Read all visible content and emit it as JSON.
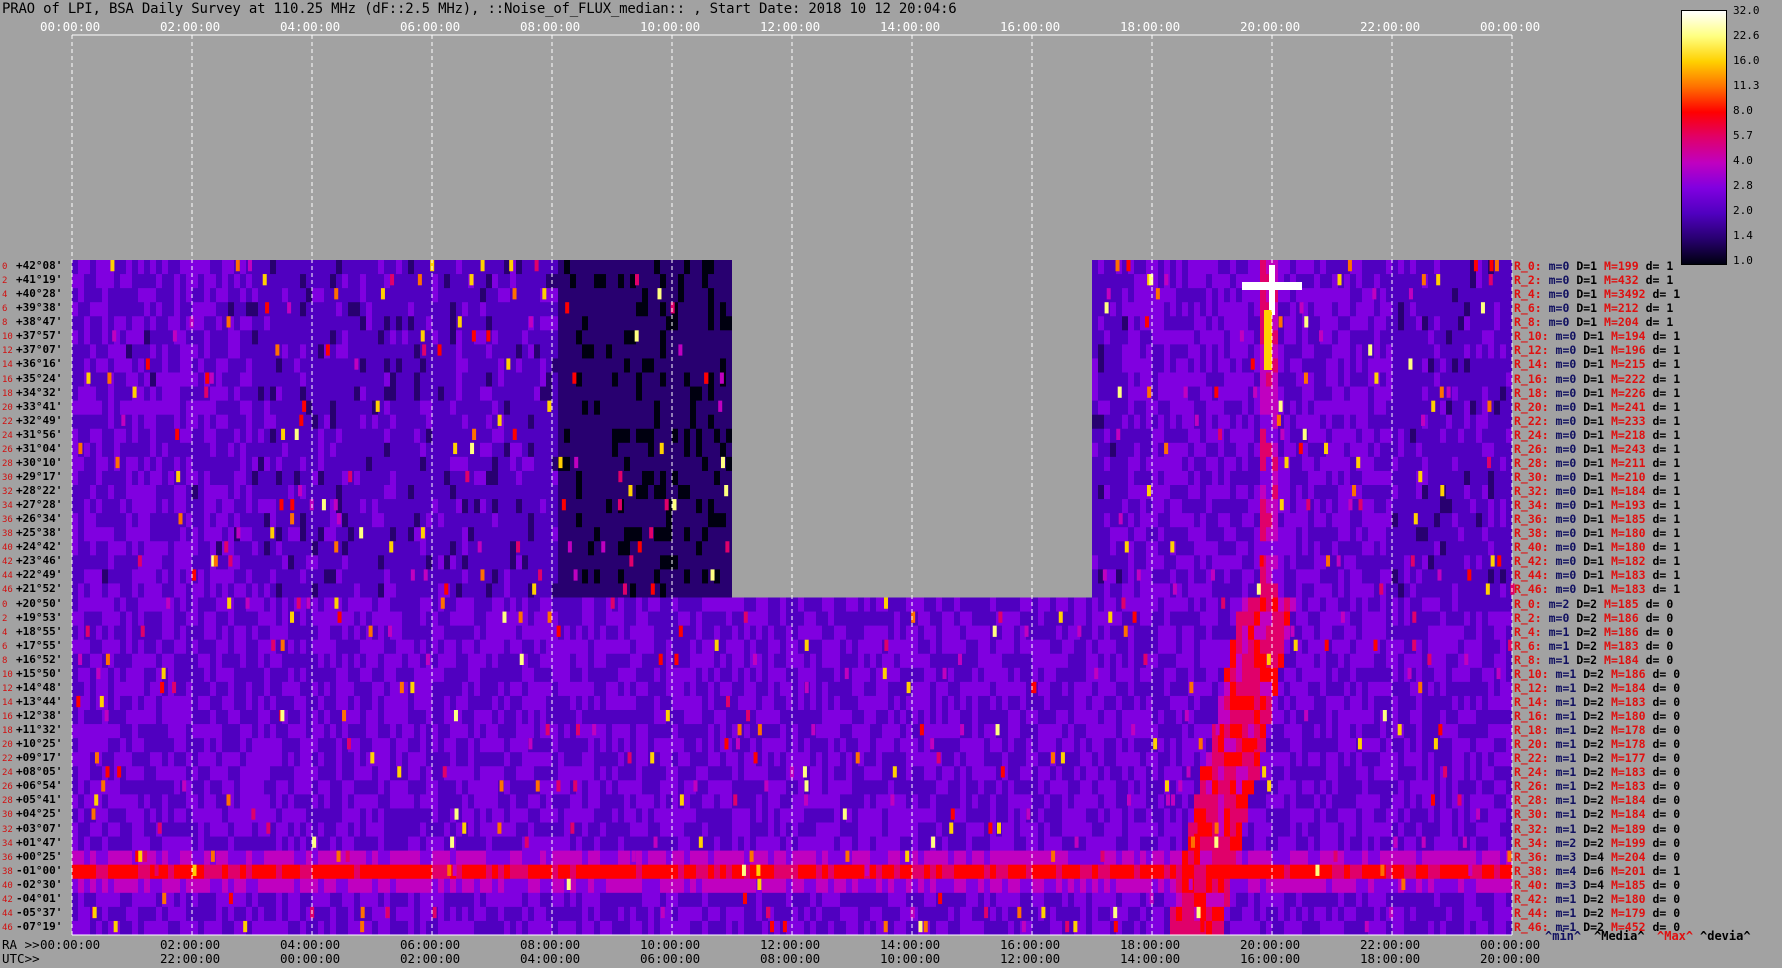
{
  "title": "PRAO of LPI, BSA Daily Survey at 110.25 MHz (dF::2.5 MHz), ::Noise_of_FLUX_median:: , Start Date: 2018 10 12 20:04:6",
  "chart_data": {
    "type": "heatmap",
    "title": "PRAO of LPI, BSA Daily Survey at 110.25 MHz (dF::2.5 MHz), ::Noise_of_FLUX_median:: , Start Date: 2018 10 12 20:04:6",
    "x_top_ticks": [
      "00:00:00",
      "02:00:00",
      "04:00:00",
      "06:00:00",
      "08:00:00",
      "10:00:00",
      "12:00:00",
      "14:00:00",
      "16:00:00",
      "18:00:00",
      "20:00:00",
      "22:00:00",
      "00:00:00"
    ],
    "x_bottom_ra_ticks": [
      "00:00:00",
      "02:00:00",
      "04:00:00",
      "06:00:00",
      "08:00:00",
      "10:00:00",
      "12:00:00",
      "14:00:00",
      "16:00:00",
      "18:00:00",
      "20:00:00",
      "22:00:00",
      "00:00:00"
    ],
    "x_bottom_utc_ticks": [
      "22:00:00",
      "00:00:00",
      "02:00:00",
      "04:00:00",
      "06:00:00",
      "08:00:00",
      "10:00:00",
      "12:00:00",
      "14:00:00",
      "16:00:00",
      "18:00:00",
      "20:00:00"
    ],
    "ra_axis_label": "RA >>",
    "utc_axis_label": "UTC>>",
    "xlim_hours": [
      0,
      24
    ],
    "declinations": [
      "+42°08'",
      "+41°19'",
      "+40°28'",
      "+39°38'",
      "+38°47'",
      "+37°57'",
      "+37°07'",
      "+36°16'",
      "+35°24'",
      "+34°32'",
      "+33°41'",
      "+32°49'",
      "+31°56'",
      "+31°04'",
      "+30°10'",
      "+29°17'",
      "+28°22'",
      "+27°28'",
      "+26°34'",
      "+25°38'",
      "+24°42'",
      "+23°46'",
      "+22°49'",
      "+21°52'",
      "+20°50'",
      "+19°53'",
      "+18°55'",
      "+17°55'",
      "+16°52'",
      "+15°50'",
      "+14°48'",
      "+13°44'",
      "+12°38'",
      "+11°32'",
      "+10°25'",
      "+09°17'",
      "+08°05'",
      "+06°54'",
      "+05°41'",
      "+04°25'",
      "+03°07'",
      "+01°47'",
      "+00°25'",
      "-01°00'",
      "-02°30'",
      "-04°01'",
      "-05°37'",
      "-07°19'"
    ],
    "row_indices_left": [
      "0",
      "2",
      "4",
      "6",
      "8",
      "10",
      "12",
      "14",
      "16",
      "18",
      "20",
      "22",
      "24",
      "26",
      "28",
      "30",
      "32",
      "34",
      "36",
      "38",
      "40",
      "42",
      "44",
      "46",
      "0",
      "2",
      "4",
      "6",
      "8",
      "10",
      "12",
      "14",
      "16",
      "18",
      "20",
      "22",
      "24",
      "26",
      "28",
      "30",
      "32",
      "34",
      "36",
      "38",
      "40",
      "42",
      "44",
      "46"
    ],
    "missing_data_hours": [
      {
        "rows": "upper",
        "from": 11.0,
        "to": 17.0
      },
      {
        "rows": "lower",
        "from": 0,
        "to": 0
      }
    ],
    "features": [
      {
        "name": "radio source band",
        "dec": "-01°00'",
        "level": 8.0
      },
      {
        "name": "bright source",
        "ra_hours": 20.0,
        "dec": "+41°19'",
        "level": 32.0
      },
      {
        "name": "drifting interference track",
        "ra_from_hours": 18.6,
        "ra_to_hours": 20.0,
        "level": 11.3
      }
    ],
    "colorbar": {
      "ticks": [
        "32.0",
        "22.6",
        "16.0",
        "11.3",
        "8.0",
        "5.7",
        "4.0",
        "2.8",
        "2.0",
        "1.4",
        "1.0"
      ],
      "scale": "log",
      "colors": [
        "#ffffff",
        "#ffff80",
        "#ffd000",
        "#ff7000",
        "#ff0000",
        "#e0006a",
        "#c000c0",
        "#8000e0",
        "#5000c0",
        "#280070",
        "#000010"
      ]
    }
  },
  "row_stats": [
    {
      "r": "R_0:",
      "mn": "m=0",
      "dv": "D=1",
      "mx": "M=199",
      "d": "d= 1"
    },
    {
      "r": "R_2:",
      "mn": "m=0",
      "dv": "D=1",
      "mx": "M=432",
      "d": "d= 1"
    },
    {
      "r": "R_4:",
      "mn": "m=0",
      "dv": "D=1",
      "mx": "M=3492",
      "d": "d= 1"
    },
    {
      "r": "R_6:",
      "mn": "m=0",
      "dv": "D=1",
      "mx": "M=212",
      "d": "d= 1"
    },
    {
      "r": "R_8:",
      "mn": "m=0",
      "dv": "D=1",
      "mx": "M=204",
      "d": "d= 1"
    },
    {
      "r": "R_10:",
      "mn": "m=0",
      "dv": "D=1",
      "mx": "M=194",
      "d": "d= 1"
    },
    {
      "r": "R_12:",
      "mn": "m=0",
      "dv": "D=1",
      "mx": "M=196",
      "d": "d= 1"
    },
    {
      "r": "R_14:",
      "mn": "m=0",
      "dv": "D=1",
      "mx": "M=215",
      "d": "d= 1"
    },
    {
      "r": "R_16:",
      "mn": "m=0",
      "dv": "D=1",
      "mx": "M=222",
      "d": "d= 1"
    },
    {
      "r": "R_18:",
      "mn": "m=0",
      "dv": "D=1",
      "mx": "M=226",
      "d": "d= 1"
    },
    {
      "r": "R_20:",
      "mn": "m=0",
      "dv": "D=1",
      "mx": "M=241",
      "d": "d= 1"
    },
    {
      "r": "R_22:",
      "mn": "m=0",
      "dv": "D=1",
      "mx": "M=233",
      "d": "d= 1"
    },
    {
      "r": "R_24:",
      "mn": "m=0",
      "dv": "D=1",
      "mx": "M=218",
      "d": "d= 1"
    },
    {
      "r": "R_26:",
      "mn": "m=0",
      "dv": "D=1",
      "mx": "M=243",
      "d": "d= 1"
    },
    {
      "r": "R_28:",
      "mn": "m=0",
      "dv": "D=1",
      "mx": "M=211",
      "d": "d= 1"
    },
    {
      "r": "R_30:",
      "mn": "m=0",
      "dv": "D=1",
      "mx": "M=210",
      "d": "d= 1"
    },
    {
      "r": "R_32:",
      "mn": "m=0",
      "dv": "D=1",
      "mx": "M=184",
      "d": "d= 1"
    },
    {
      "r": "R_34:",
      "mn": "m=0",
      "dv": "D=1",
      "mx": "M=193",
      "d": "d= 1"
    },
    {
      "r": "R_36:",
      "mn": "m=0",
      "dv": "D=1",
      "mx": "M=185",
      "d": "d= 1"
    },
    {
      "r": "R_38:",
      "mn": "m=0",
      "dv": "D=1",
      "mx": "M=180",
      "d": "d= 1"
    },
    {
      "r": "R_40:",
      "mn": "m=0",
      "dv": "D=1",
      "mx": "M=180",
      "d": "d= 1"
    },
    {
      "r": "R_42:",
      "mn": "m=0",
      "dv": "D=1",
      "mx": "M=182",
      "d": "d= 1"
    },
    {
      "r": "R_44:",
      "mn": "m=0",
      "dv": "D=1",
      "mx": "M=183",
      "d": "d= 1"
    },
    {
      "r": "R_46:",
      "mn": "m=0",
      "dv": "D=1",
      "mx": "M=183",
      "d": "d= 1"
    },
    {
      "r": "R_0:",
      "mn": "m=2",
      "dv": "D=2",
      "mx": "M=185",
      "d": "d= 0"
    },
    {
      "r": "R_2:",
      "mn": "m=0",
      "dv": "D=2",
      "mx": "M=186",
      "d": "d= 0"
    },
    {
      "r": "R_4:",
      "mn": "m=1",
      "dv": "D=2",
      "mx": "M=186",
      "d": "d= 0"
    },
    {
      "r": "R_6:",
      "mn": "m=1",
      "dv": "D=2",
      "mx": "M=183",
      "d": "d= 0"
    },
    {
      "r": "R_8:",
      "mn": "m=1",
      "dv": "D=2",
      "mx": "M=184",
      "d": "d= 0"
    },
    {
      "r": "R_10:",
      "mn": "m=1",
      "dv": "D=2",
      "mx": "M=186",
      "d": "d= 0"
    },
    {
      "r": "R_12:",
      "mn": "m=1",
      "dv": "D=2",
      "mx": "M=184",
      "d": "d= 0"
    },
    {
      "r": "R_14:",
      "mn": "m=1",
      "dv": "D=2",
      "mx": "M=183",
      "d": "d= 0"
    },
    {
      "r": "R_16:",
      "mn": "m=1",
      "dv": "D=2",
      "mx": "M=180",
      "d": "d= 0"
    },
    {
      "r": "R_18:",
      "mn": "m=1",
      "dv": "D=2",
      "mx": "M=178",
      "d": "d= 0"
    },
    {
      "r": "R_20:",
      "mn": "m=1",
      "dv": "D=2",
      "mx": "M=178",
      "d": "d= 0"
    },
    {
      "r": "R_22:",
      "mn": "m=1",
      "dv": "D=2",
      "mx": "M=177",
      "d": "d= 0"
    },
    {
      "r": "R_24:",
      "mn": "m=1",
      "dv": "D=2",
      "mx": "M=183",
      "d": "d= 0"
    },
    {
      "r": "R_26:",
      "mn": "m=1",
      "dv": "D=2",
      "mx": "M=183",
      "d": "d= 0"
    },
    {
      "r": "R_28:",
      "mn": "m=1",
      "dv": "D=2",
      "mx": "M=184",
      "d": "d= 0"
    },
    {
      "r": "R_30:",
      "mn": "m=1",
      "dv": "D=2",
      "mx": "M=184",
      "d": "d= 0"
    },
    {
      "r": "R_32:",
      "mn": "m=1",
      "dv": "D=2",
      "mx": "M=189",
      "d": "d= 0"
    },
    {
      "r": "R_34:",
      "mn": "m=2",
      "dv": "D=2",
      "mx": "M=199",
      "d": "d= 0"
    },
    {
      "r": "R_36:",
      "mn": "m=3",
      "dv": "D=4",
      "mx": "M=204",
      "d": "d= 0"
    },
    {
      "r": "R_38:",
      "mn": "m=4",
      "dv": "D=6",
      "mx": "M=201",
      "d": "d= 1"
    },
    {
      "r": "R_40:",
      "mn": "m=3",
      "dv": "D=4",
      "mx": "M=185",
      "d": "d= 0"
    },
    {
      "r": "R_42:",
      "mn": "m=1",
      "dv": "D=2",
      "mx": "M=180",
      "d": "d= 0"
    },
    {
      "r": "R_44:",
      "mn": "m=1",
      "dv": "D=2",
      "mx": "M=179",
      "d": "d= 0"
    },
    {
      "r": "R_46:",
      "mn": "m=1",
      "dv": "D=2",
      "mx": "M=452",
      "d": "d= 0"
    }
  ],
  "legend": {
    "min": "^min^",
    "median": "^Media^",
    "max": "^Max^",
    "deviation": "^devia^"
  },
  "colors": {
    "min": "#101060",
    "median": "#000000",
    "max": "#e01010",
    "deviation": "#000000",
    "background": "#a2a2a2"
  }
}
